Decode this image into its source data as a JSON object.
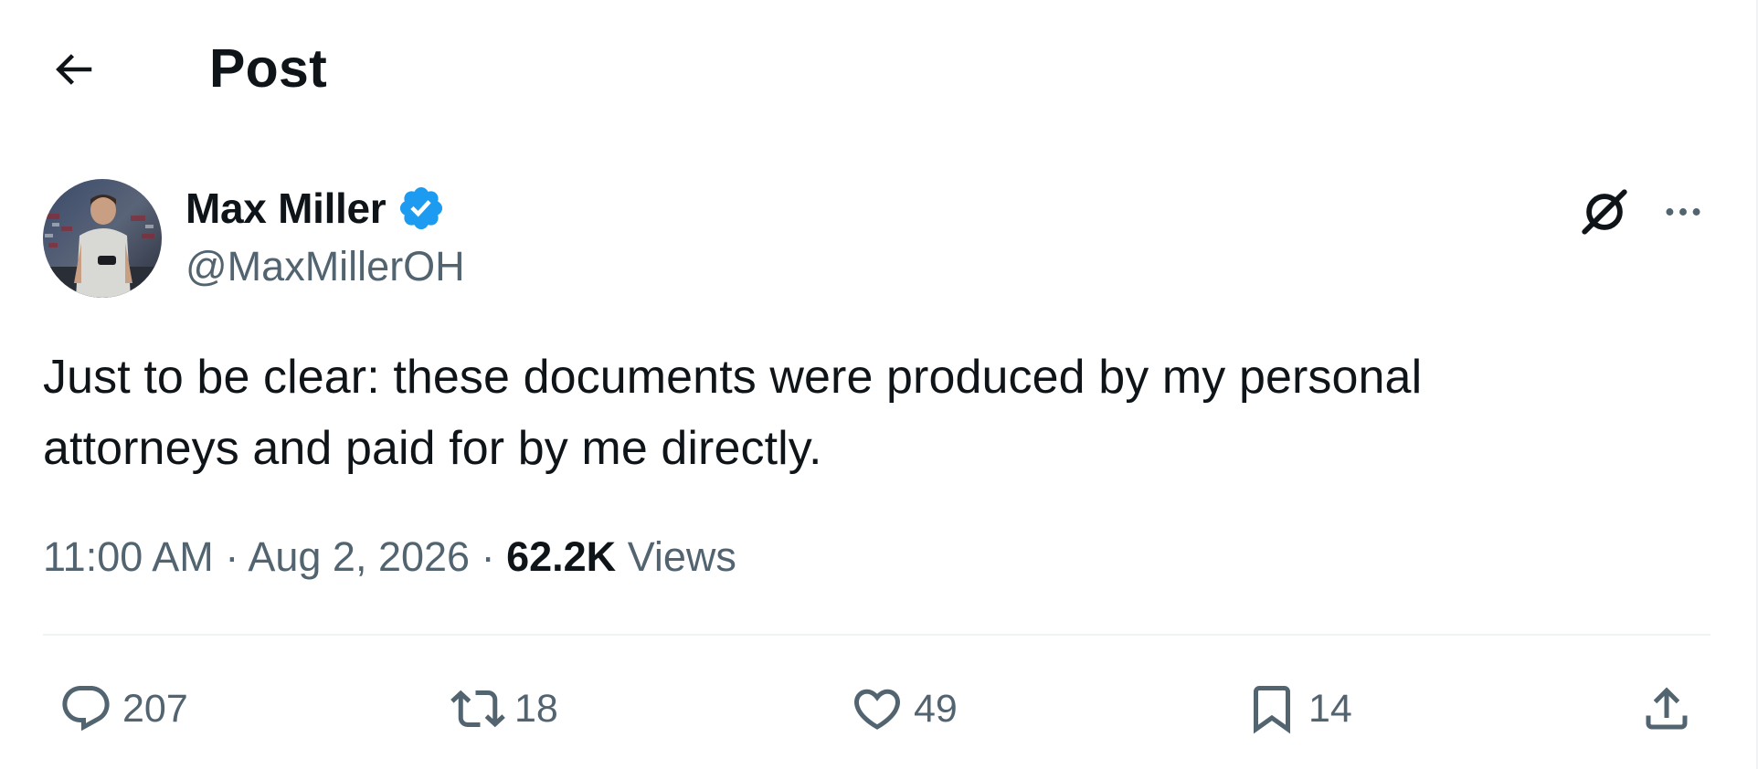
{
  "header": {
    "title": "Post"
  },
  "author": {
    "name": "Max Miller",
    "handle": "@MaxMillerOH",
    "verified": true
  },
  "post": {
    "text": "Just to be clear: these documents were produced by my personal\nattorneys and paid for by me directly.",
    "time": "11:00 AM",
    "separator": "·",
    "date": "Aug 2, 2026",
    "views_count": "62.2K",
    "views_label": "Views"
  },
  "actions": {
    "replies": "207",
    "reposts": "18",
    "likes": "49",
    "bookmarks": "14"
  },
  "icons": {
    "back": "arrow-left-icon",
    "verified": "verified-badge-icon",
    "grok": "grok-icon",
    "more": "more-horizontal-icon",
    "reply": "reply-icon",
    "repost": "repost-icon",
    "like": "heart-icon",
    "bookmark": "bookmark-icon",
    "share": "share-icon"
  },
  "colors": {
    "text_primary": "#0f1419",
    "text_secondary": "#536471",
    "verified_blue": "#1d9bf0",
    "divider": "#eff3f4"
  }
}
